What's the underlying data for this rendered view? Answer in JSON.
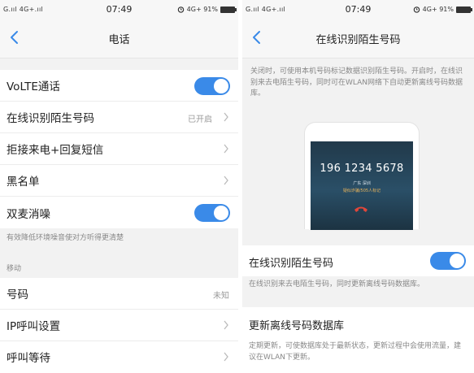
{
  "left": {
    "status": {
      "signal": "G.ııl 4G+.ııl",
      "time": "07:49",
      "indicators": "4G+ 91%"
    },
    "nav": {
      "title": "电话"
    },
    "rows": [
      {
        "label": "VoLTE通话",
        "toggle": true
      },
      {
        "label": "在线识别陌生号码",
        "value": "已开启",
        "chevron": true
      },
      {
        "label": "拒接来电+回复短信",
        "chevron": true
      },
      {
        "label": "黑名单",
        "chevron": true
      },
      {
        "label": "双麦消噪",
        "toggle": true
      }
    ],
    "hint": "有效降低环境噪音使对方听得更清楚",
    "section": "移动",
    "rows2": [
      {
        "label": "号码",
        "value": "未知"
      },
      {
        "label": "IP呼叫设置",
        "chevron": true
      },
      {
        "label": "呼叫等待",
        "chevron": true
      }
    ]
  },
  "right": {
    "status": {
      "signal": "G.ııl 4G+.ııl",
      "time": "07:49",
      "indicators": "4G+ 91%"
    },
    "nav": {
      "title": "在线识别陌生号码"
    },
    "description": "关闭时，可使用本机号码标记数据识别陌生号码。开启时，在线识别来去电陌生号码，同时可在WLAN网络下自动更新离线号码数据库。",
    "phone": {
      "number": "196 1234 5678",
      "location": "广东 深圳",
      "tag": "疑似诈骗/505人标记"
    },
    "online": {
      "title": "在线识别陌生号码",
      "desc": "在线识别来去电陌生号码，同时更新离线号码数据库。",
      "toggle": true
    },
    "offline": {
      "title": "更新离线号码数据库",
      "desc": "定期更新，可使数据库处于最新状态，更新过程中会使用流量，建议在WLAN下更新。"
    }
  },
  "colors": {
    "accent": "#3a8ae8",
    "background": "#f2f2f2",
    "hint": "#888888"
  },
  "icons": [
    "back-arrow-icon",
    "chevron-right-icon",
    "alarm-icon",
    "battery-icon",
    "hangup-icon"
  ]
}
